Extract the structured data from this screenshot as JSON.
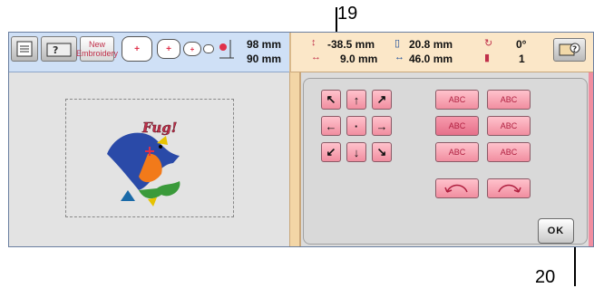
{
  "callouts": {
    "top": "19",
    "bottom": "20"
  },
  "toolbar": {
    "new_embroidery_line1": "New",
    "new_embroidery_line2": "Embroidery",
    "hoop_marker": "+",
    "size_height": "98 mm",
    "size_width": "90 mm",
    "pos_y": "-38.5 mm",
    "pos_x": "9.0 mm",
    "dim_h": "20.8 mm",
    "dim_w": "46.0 mm",
    "rotation": "0°",
    "thread_count": "1"
  },
  "design": {
    "label": "Fug!"
  },
  "edit_panel": {
    "arrows": [
      "↖",
      "↑",
      "↗",
      "←",
      "·",
      "→",
      "↙",
      "↓",
      "↘"
    ],
    "text_buttons": [
      "ABC",
      "ABC",
      "ABC",
      "ABC",
      "ABC",
      "ABC"
    ],
    "ok_label": "OK"
  },
  "colors": {
    "accent_pink": "#f18ea0",
    "toolbar_blue": "#cfe0f6",
    "toolbar_orange": "#fbe7c8"
  }
}
